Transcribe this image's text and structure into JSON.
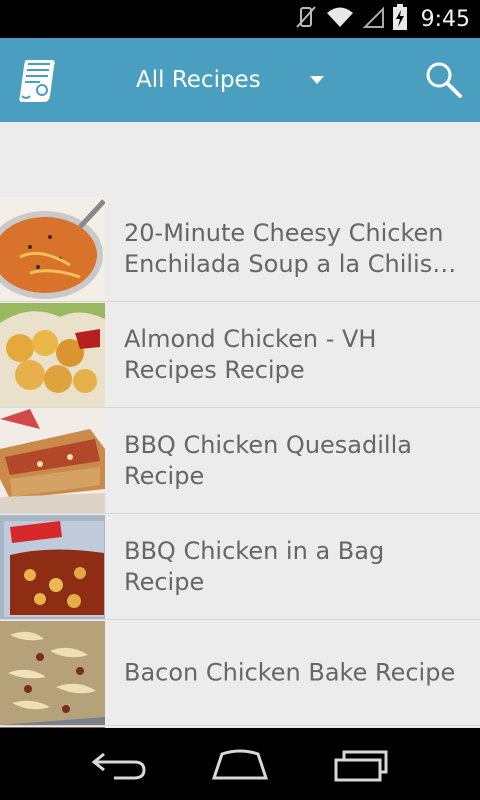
{
  "status_bar": {
    "time": "9:45"
  },
  "action_bar": {
    "spinner_label": "All Recipes"
  },
  "recipes": [
    {
      "title": "20-Minute Cheesy Chicken Enchilada Soup a la Chilis…"
    },
    {
      "title": "Almond Chicken - VH Recipes Recipe"
    },
    {
      "title": "BBQ Chicken Quesadilla Recipe"
    },
    {
      "title": "BBQ Chicken in a Bag Recipe"
    },
    {
      "title": "Bacon Chicken Bake Recipe"
    }
  ],
  "colors": {
    "action_bar": "#4a9fc0",
    "list_bg": "#ececec",
    "title_text": "#666666"
  },
  "icons": {
    "app": "recipe-scroll-icon",
    "search": "search-icon",
    "back": "back-icon",
    "home": "home-icon",
    "recents": "recents-icon"
  }
}
